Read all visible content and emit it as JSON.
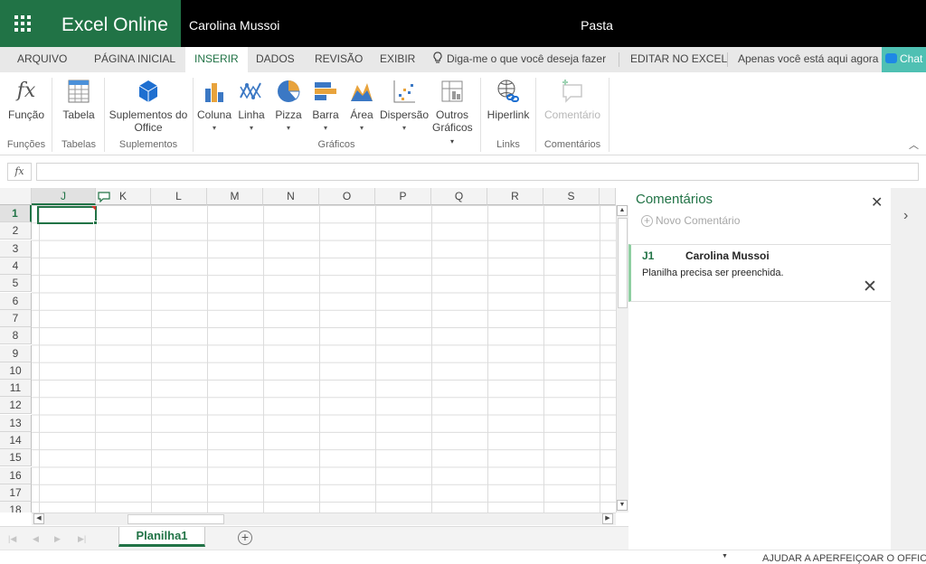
{
  "header": {
    "app_name": "Excel Online",
    "user_name": "Carolina Mussoi",
    "document_name": "Pasta"
  },
  "tabs": [
    "ARQUIVO",
    "PÁGINA INICIAL",
    "INSERIR",
    "DADOS",
    "REVISÃO",
    "EXIBIR"
  ],
  "active_tab": "INSERIR",
  "tell_me": "Diga-me o que você deseja fazer",
  "edit_in_excel": "EDITAR NO EXCEL",
  "presence": "Apenas você está aqui agora",
  "chat": "Chat",
  "ribbon": {
    "buttons": {
      "funcao": "Função",
      "tabela": "Tabela",
      "suplementos": "Suplementos do Office",
      "coluna": "Coluna",
      "linha": "Linha",
      "pizza": "Pizza",
      "barra": "Barra",
      "area": "Área",
      "dispersao": "Dispersão",
      "outros": "Outros Gráficos",
      "hiperlink": "Hiperlink",
      "comentario": "Comentário"
    },
    "groups": {
      "funcoes": "Funções",
      "tabelas": "Tabelas",
      "suplementos": "Suplementos",
      "graficos": "Gráficos",
      "links": "Links",
      "comentarios": "Comentários"
    }
  },
  "formula_bar": {
    "fx": "fx",
    "value": ""
  },
  "grid": {
    "columns": [
      "J",
      "K",
      "L",
      "M",
      "N",
      "O",
      "P",
      "Q",
      "R",
      "S"
    ],
    "rows": [
      "1",
      "2",
      "3",
      "4",
      "5",
      "6",
      "7",
      "8",
      "9",
      "10",
      "11",
      "12",
      "13",
      "14",
      "15",
      "16",
      "17",
      "18"
    ],
    "selected_cell": "J1"
  },
  "sheet": {
    "name": "Planilha1"
  },
  "comments_pane": {
    "title": "Comentários",
    "new_comment": "Novo Comentário",
    "comment": {
      "cell": "J1",
      "author": "Carolina Mussoi",
      "text": "Planilha precisa ser preenchida."
    }
  },
  "status": {
    "help": "AJUDAR A APERFEIÇOAR O OFFICE"
  },
  "colors": {
    "accent": "#217346",
    "chat": "#4fc0b3",
    "comment_marker": "#d1342a"
  }
}
